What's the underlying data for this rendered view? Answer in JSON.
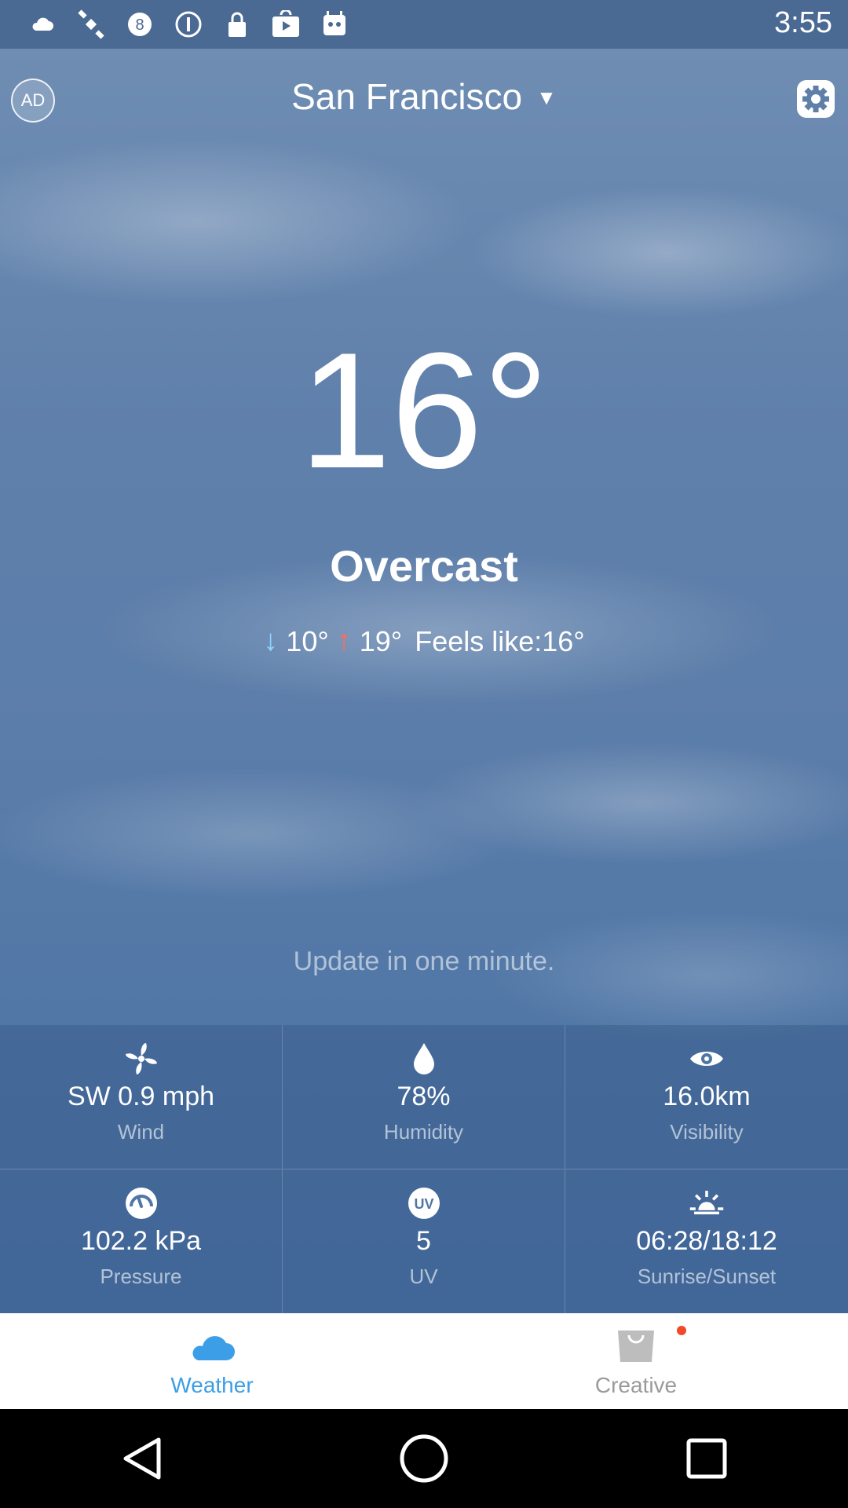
{
  "status_bar": {
    "time": "3:55",
    "icons": [
      "cloud-icon",
      "satellite-icon",
      "eight-badge-icon",
      "info-circle-icon",
      "lock-icon",
      "play-store-icon",
      "android-bot-icon"
    ]
  },
  "header": {
    "ad_label": "AD",
    "city": "San Francisco",
    "caret": "▼"
  },
  "current": {
    "temperature": "16°",
    "condition": "Overcast",
    "low": "10°",
    "high": "19°",
    "feels_like": "Feels like:16°",
    "update_text": "Update in one minute."
  },
  "details": [
    {
      "value": "SW 0.9 mph",
      "label": "Wind",
      "icon": "fan-icon"
    },
    {
      "value": "78%",
      "label": "Humidity",
      "icon": "drop-icon"
    },
    {
      "value": "16.0km",
      "label": "Visibility",
      "icon": "eye-icon"
    },
    {
      "value": "102.2 kPa",
      "label": "Pressure",
      "icon": "gauge-icon"
    },
    {
      "value": "5",
      "label": "UV",
      "icon": "uv-icon"
    },
    {
      "value": "06:28/18:12",
      "label": "Sunrise/Sunset",
      "icon": "sunrise-icon"
    }
  ],
  "tabs": [
    {
      "label": "Weather",
      "icon": "cloud-icon",
      "active": true
    },
    {
      "label": "Creative",
      "icon": "bag-icon",
      "active": false
    }
  ],
  "colors": {
    "active_tab": "#3c9ee6",
    "inactive_tab": "#9a9a9a",
    "low_arrow": "#8fd3ff",
    "high_arrow": "#ff6b5a",
    "notification_dot": "#f04a2a"
  }
}
